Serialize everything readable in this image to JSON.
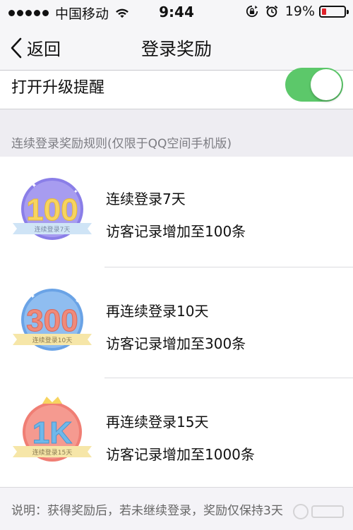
{
  "status_bar": {
    "carrier": "中国移动",
    "time": "9:44",
    "battery": "19%",
    "signal_icon": "signal-dots-icon",
    "wifi_icon": "wifi-icon",
    "lock_icon": "rotation-lock-icon",
    "alarm_icon": "alarm-clock-icon"
  },
  "nav": {
    "back_label": "返回",
    "title": "登录奖励"
  },
  "upgrade_toggle": {
    "label": "打开升级提醒",
    "on": true,
    "color": "#5cc86a"
  },
  "section_header": "连续登录奖励规则(仅限于QQ空间手机版)",
  "rewards": [
    {
      "badge_number": "100",
      "badge_ribbon": "连续登录7天",
      "title": "连续登录7天",
      "desc": "访客记录增加至100条",
      "badge_color": "#8a7ee8",
      "number_color": "#f7d460"
    },
    {
      "badge_number": "300",
      "badge_ribbon": "连续登录10天",
      "title": "再连续登录10天",
      "desc": "访客记录增加至300条",
      "badge_color": "#6aa3e6",
      "number_color": "#f08a7a"
    },
    {
      "badge_number": "1K",
      "badge_ribbon": "连续登录15天",
      "title": "再连续登录15天",
      "desc": "访客记录增加至1000条",
      "badge_color": "#f07e74",
      "number_color": "#6fb8ea"
    }
  ],
  "footer_note": "说明：获得奖励后，若未继续登录，奖励仅保持3天"
}
